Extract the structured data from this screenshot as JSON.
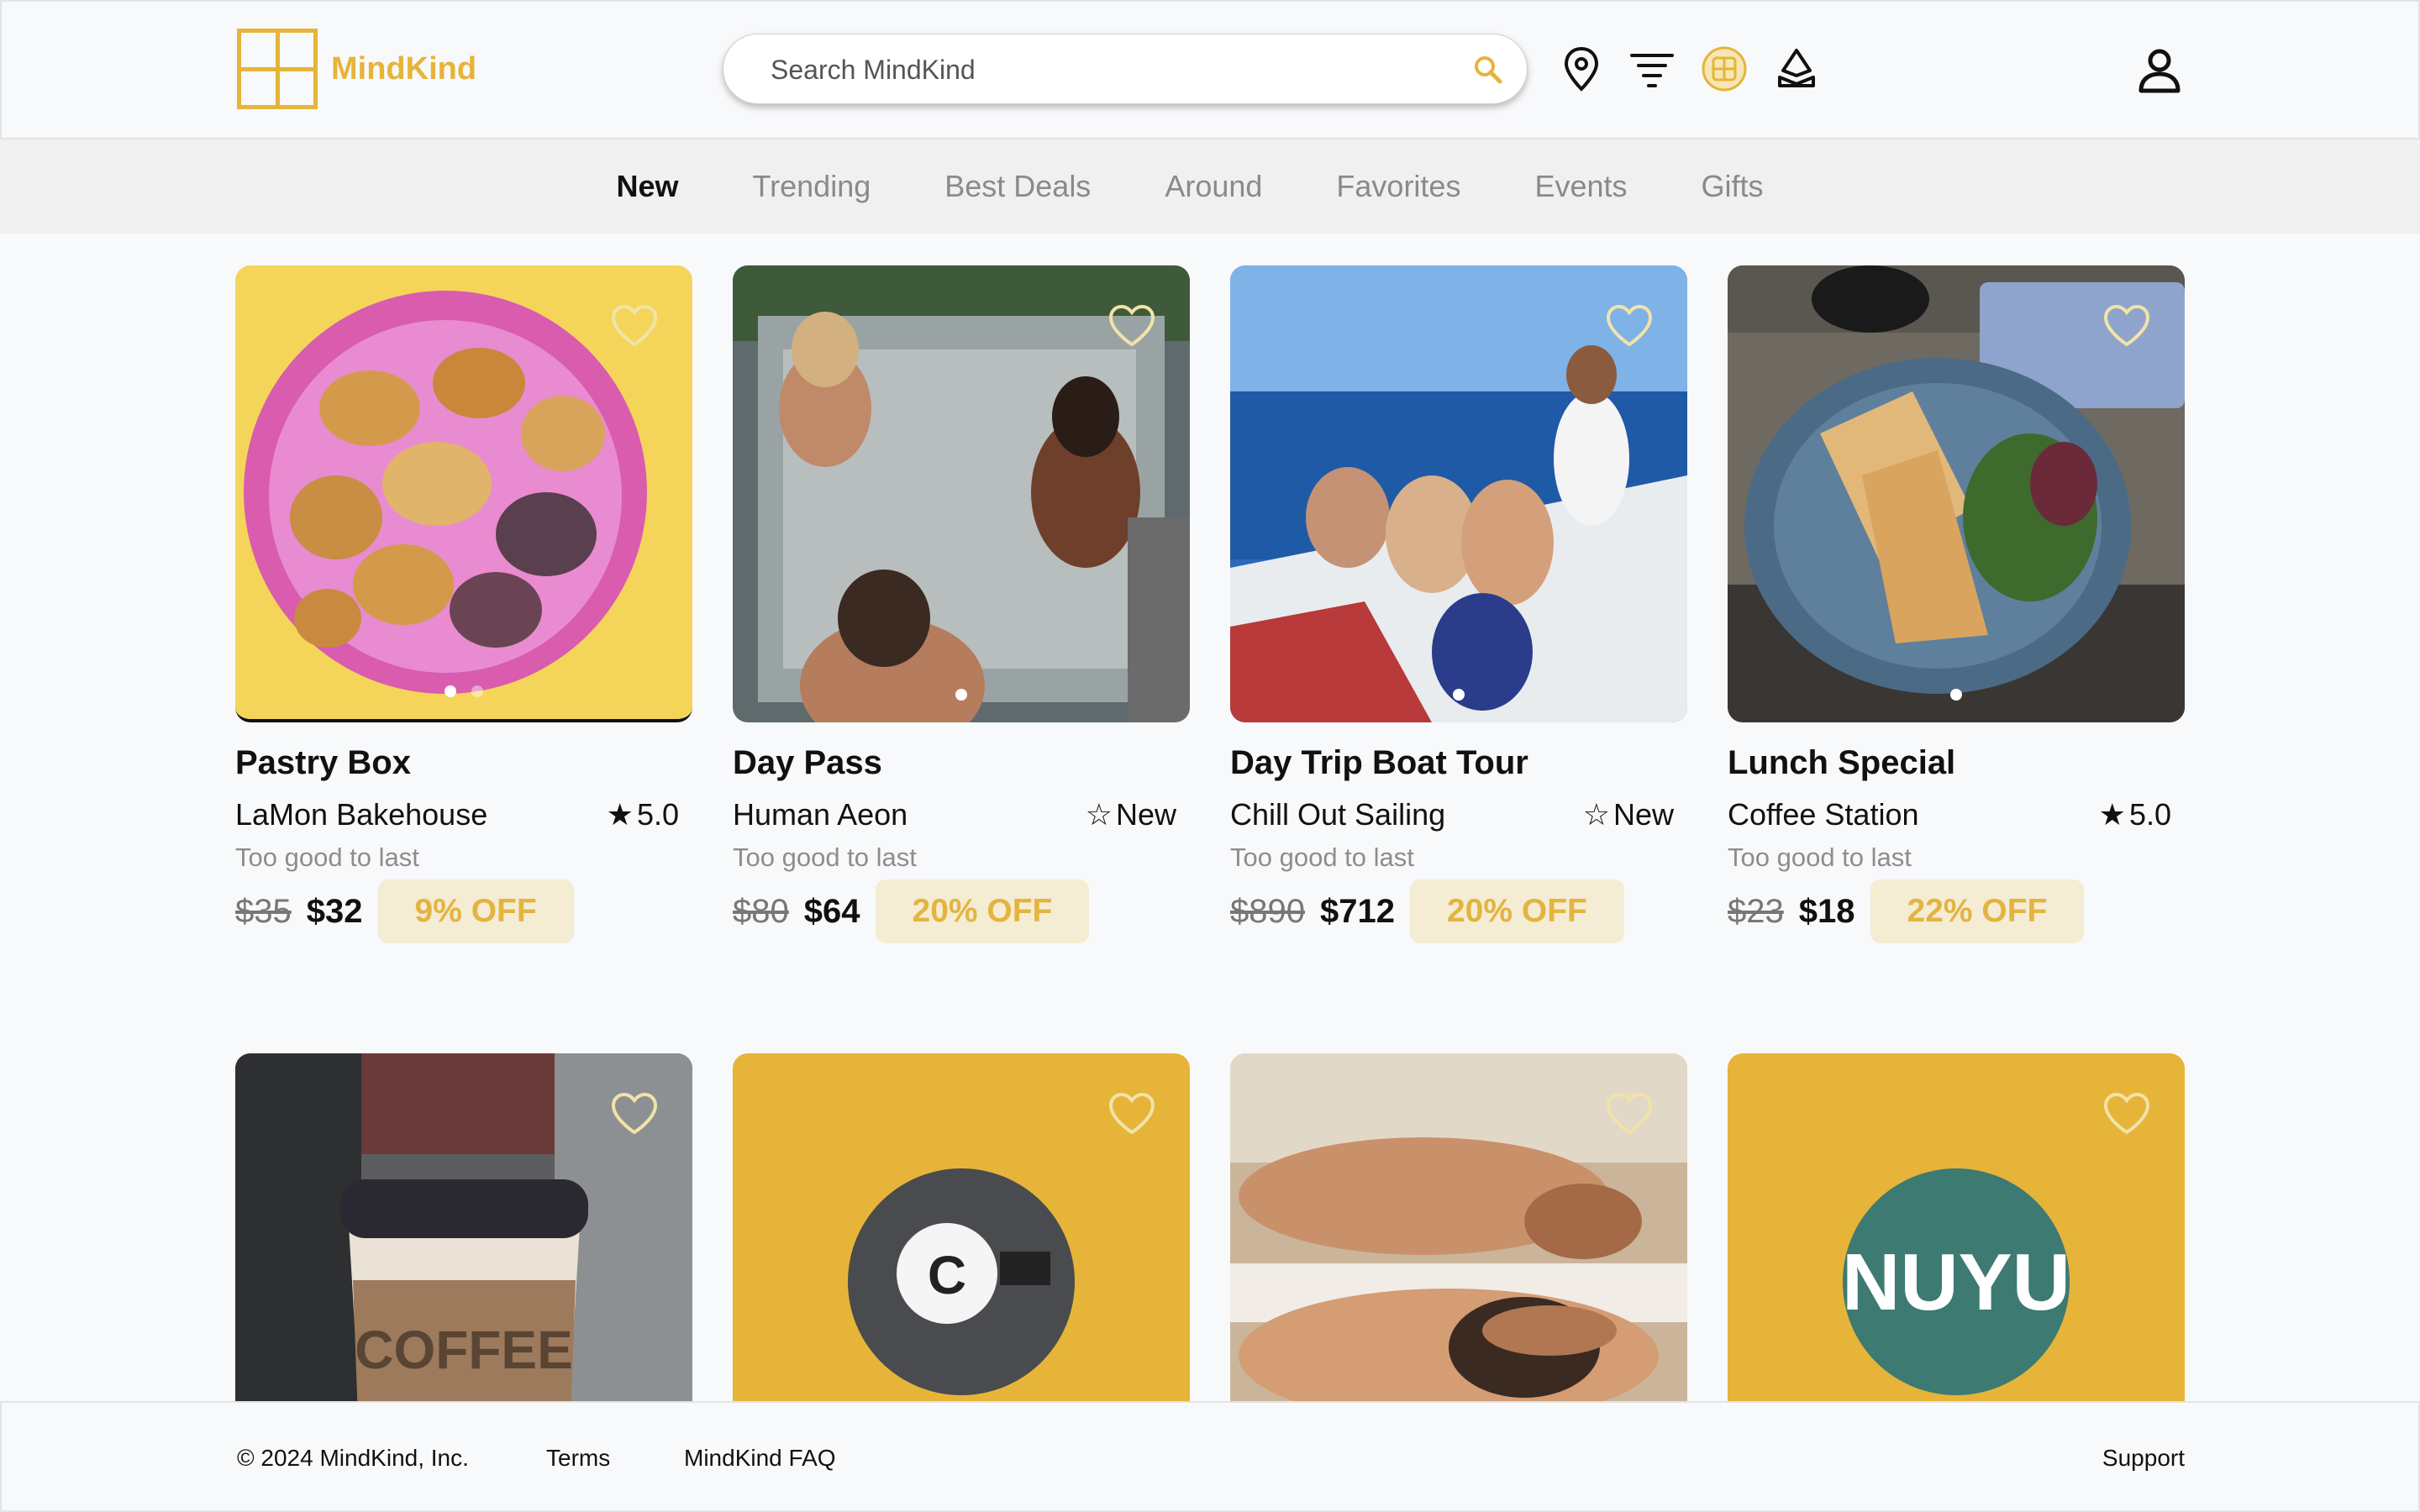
{
  "brand": {
    "name": "MindKind",
    "color": "#e6b438"
  },
  "search": {
    "placeholder": "Search MindKind"
  },
  "header_icons": [
    "location-pin-icon",
    "filter-icon",
    "grid-view-icon",
    "map-icon",
    "account-icon"
  ],
  "nav": {
    "tabs": [
      "New",
      "Trending",
      "Best Deals",
      "Around",
      "Favorites",
      "Events",
      "Gifts"
    ],
    "active": "New"
  },
  "cards": [
    {
      "title": "Pastry Box",
      "vendor": "LaMon Bakehouse",
      "rating": "5.0",
      "tagline": "Too good to last",
      "old_price": "$35",
      "price": "$32",
      "discount": "9% OFF"
    },
    {
      "title": "Day Pass",
      "vendor": "Human Aeon",
      "rating": "New",
      "tagline": "Too good to last",
      "old_price": "$80",
      "price": "$64",
      "discount": "20% OFF"
    },
    {
      "title": "Day Trip Boat Tour",
      "vendor": "Chill Out Sailing",
      "rating": "New",
      "tagline": "Too good to last",
      "old_price": "$890",
      "price": "$712",
      "discount": "20% OFF"
    },
    {
      "title": "Lunch Special",
      "vendor": "Coffee Station",
      "rating": "5.0",
      "tagline": "Too good to last",
      "old_price": "$23",
      "price": "$18",
      "discount": "22% OFF"
    }
  ],
  "row2": [
    {
      "image": "coffee-cup-photo",
      "label": "COFFEE"
    },
    {
      "image": "coffee-station-logo",
      "label": "C"
    },
    {
      "image": "massage-photo"
    },
    {
      "image": "nuyu-logo",
      "label": "NUYU"
    }
  ],
  "footer": {
    "copyright": "© 2024 MindKind, Inc.",
    "terms": "Terms",
    "faq": "MindKind FAQ",
    "support": "Support"
  }
}
